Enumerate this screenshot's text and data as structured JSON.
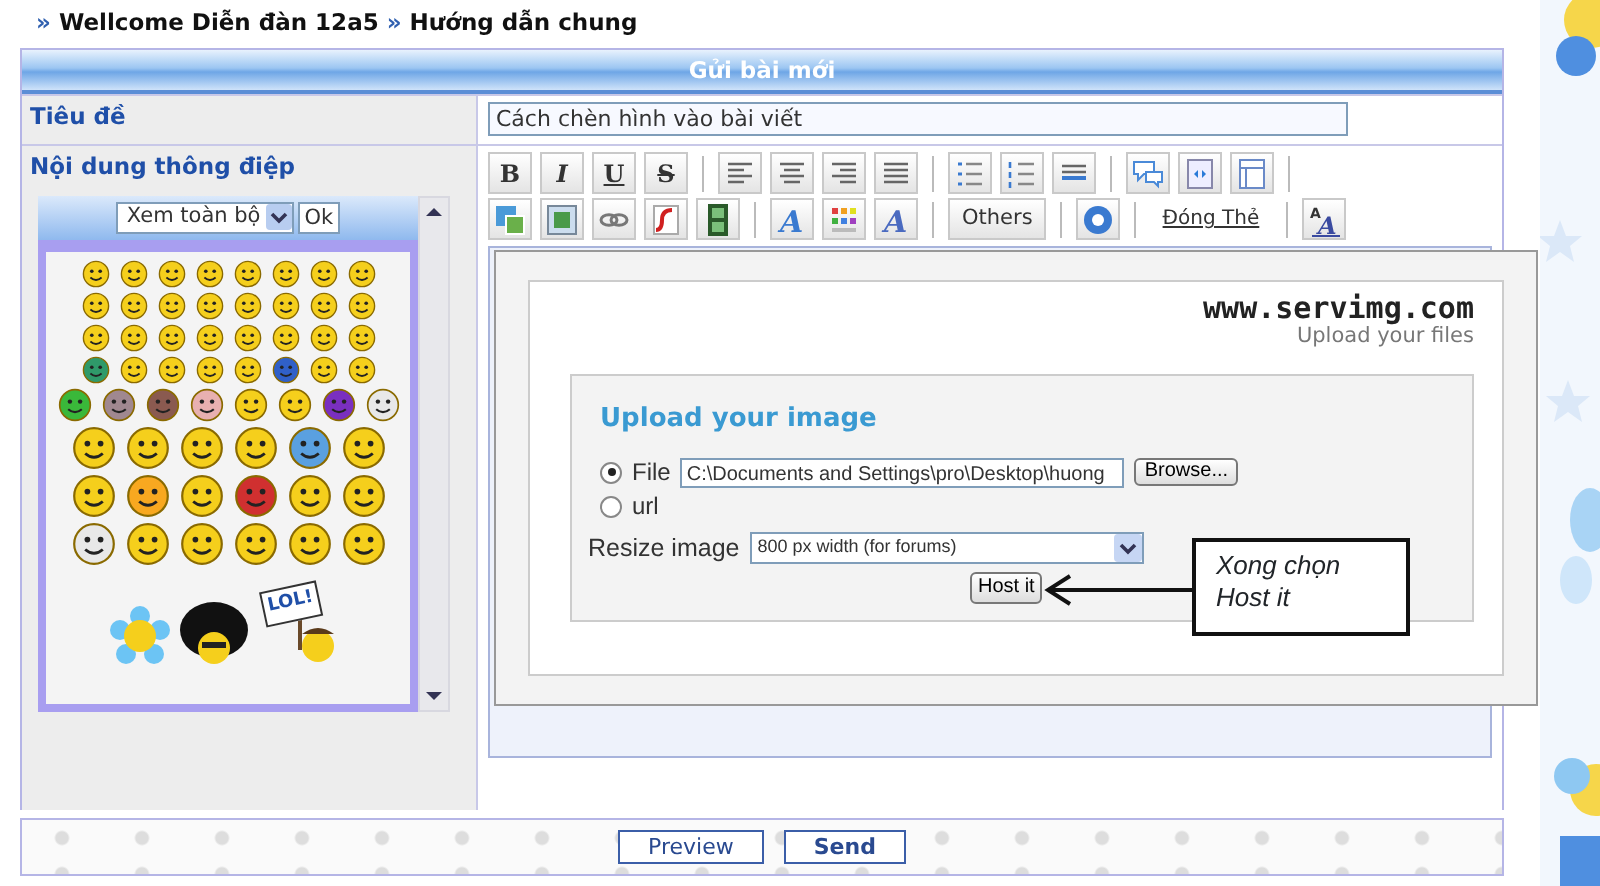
{
  "breadcrumb": [
    {
      "sep": "»",
      "label": "Wellcome Diễn đàn 12a5"
    },
    {
      "sep": "»",
      "label": "Hướng dẫn chung"
    }
  ],
  "panel_title": "Gửi bài mới",
  "subject": {
    "label": "Tiêu đề",
    "value": "Cách chèn hình vào bài viết"
  },
  "message": {
    "label": "Nội dung thông điệp"
  },
  "smilies": {
    "view_select": "Xem toàn bộ",
    "ok_button": "Ok",
    "lol_sign": "LOL!"
  },
  "toolbar": [
    [
      {
        "kind": "format",
        "label": "B"
      },
      {
        "kind": "format",
        "label": "I"
      },
      {
        "kind": "format",
        "label": "U"
      },
      {
        "kind": "format",
        "label": "S"
      },
      {
        "kind": "sep"
      },
      {
        "kind": "icon"
      },
      {
        "kind": "icon"
      },
      {
        "kind": "icon"
      },
      {
        "kind": "icon"
      },
      {
        "kind": "sep"
      },
      {
        "kind": "icon"
      },
      {
        "kind": "icon"
      },
      {
        "kind": "icon"
      },
      {
        "kind": "sep"
      },
      {
        "kind": "icon"
      },
      {
        "kind": "icon"
      },
      {
        "kind": "icon"
      },
      {
        "kind": "sep"
      }
    ],
    [
      {
        "kind": "icon"
      },
      {
        "kind": "icon"
      },
      {
        "kind": "icon"
      },
      {
        "kind": "icon"
      },
      {
        "kind": "icon"
      },
      {
        "kind": "sep"
      },
      {
        "kind": "icon",
        "glyphs": [
          "A"
        ]
      },
      {
        "kind": "icon"
      },
      {
        "kind": "icon",
        "glyphs": [
          "A"
        ]
      },
      {
        "kind": "sep"
      },
      {
        "kind": "text",
        "label": "Others"
      },
      {
        "kind": "sep"
      },
      {
        "kind": "icon"
      },
      {
        "kind": "sep"
      },
      {
        "kind": "link",
        "label": "Đóng Thẻ"
      },
      {
        "kind": "sep"
      },
      {
        "kind": "icon",
        "glyphs": [
          "A",
          "A"
        ]
      }
    ]
  ],
  "upload_popup": {
    "logo": "www.servimg.com",
    "tagline": "Upload your files",
    "heading": "Upload your image",
    "sources": [
      {
        "label": "File",
        "selected": true,
        "value": "C:\\Documents and Settings\\pro\\Desktop\\huong"
      },
      {
        "label": "url",
        "selected": false
      }
    ],
    "browse_button": "Browse...",
    "resize_label": "Resize image",
    "resize_value": "800 px width (for forums)",
    "host_button": "Host it",
    "callout": [
      "Xong chọn",
      "Host it"
    ]
  },
  "buttons": [
    "Preview",
    "Send"
  ]
}
